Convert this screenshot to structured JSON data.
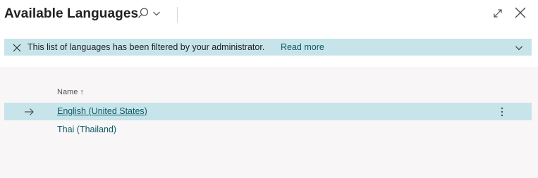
{
  "page": {
    "title": "Available Languages"
  },
  "header": {
    "search_icon": "search-icon",
    "dropdown_icon": "chevron-down-icon",
    "expand_icon": "expand-icon",
    "close_icon": "close-icon"
  },
  "banner": {
    "message": "This list of languages has been filtered by your administrator.",
    "link": "Read more",
    "color": "#c7e4ea"
  },
  "list": {
    "column_header": "Name",
    "sort_indicator": "↑",
    "rows": [
      {
        "name": "English (United States)",
        "selected": true
      },
      {
        "name": "Thai (Thailand)",
        "selected": false
      }
    ]
  },
  "colors": {
    "accent": "#0c5a63",
    "selection": "#c7e4ea",
    "list_background": "#f8f6f6"
  }
}
